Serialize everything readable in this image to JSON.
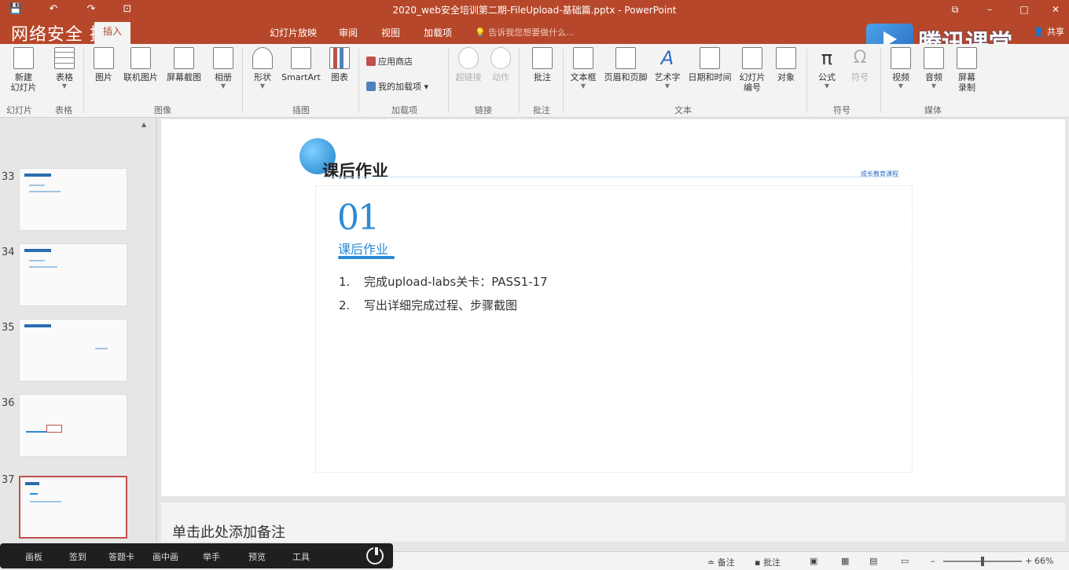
{
  "window": {
    "title": "2020_web安全培训第二期-FileUpload-基础篇.pptx - PowerPoint",
    "controls": {
      "restore": "⧉",
      "minimize": "–",
      "maximize": "□",
      "close": "✕"
    }
  },
  "quick_access": [
    "💾",
    "↶",
    "↷",
    "⊡"
  ],
  "overlay_title": "网络安全  推荐",
  "tabs": [
    {
      "label": "插入",
      "active": true
    },
    {
      "label": "幻灯片放映",
      "active": false
    },
    {
      "label": "审阅",
      "active": false
    },
    {
      "label": "视图",
      "active": false
    },
    {
      "label": "加载项",
      "active": false
    }
  ],
  "search_placeholder": "告诉我您想要做什么...",
  "share_label": "共享",
  "brand_text": "腾讯课堂",
  "ribbon": {
    "buttons": {
      "new_slide": "新建\n幻灯片",
      "table": "表格",
      "picture": "图片",
      "online_picture": "联机图片",
      "screenshot": "屏幕截图",
      "album": "相册",
      "shapes": "形状",
      "smartart": "SmartArt",
      "chart": "图表",
      "store": "应用商店",
      "my_addins": "我的加载项",
      "hyperlink": "超链接",
      "action": "动作",
      "comment": "批注",
      "textbox": "文本框",
      "header_footer": "页眉和页脚",
      "wordart": "艺术字",
      "datetime": "日期和时间",
      "slide_number": "幻灯片\n编号",
      "object": "对象",
      "equation": "公式",
      "symbol": "符号",
      "video": "视频",
      "audio": "音频",
      "screen_record": "屏幕\n录制"
    },
    "groups": {
      "slides": "幻灯片",
      "tables": "表格",
      "images": "图像",
      "illustrations": "插图",
      "addins": "加载项",
      "links": "链接",
      "comments": "批注",
      "text": "文本",
      "symbols": "符号",
      "media": "媒体"
    }
  },
  "thumbnails": [
    {
      "number": "33",
      "selected": false
    },
    {
      "number": "34",
      "selected": false
    },
    {
      "number": "35",
      "selected": false
    },
    {
      "number": "36",
      "selected": false
    },
    {
      "number": "37",
      "selected": true
    }
  ],
  "slide": {
    "title": "课后作业",
    "logo_text": "成长教育课程",
    "number": "01",
    "subheading": "课后作业",
    "items": [
      {
        "n": "1.",
        "text": "完成upload-labs关卡：PASS1-17"
      },
      {
        "n": "2.",
        "text": "写出详细完成过程、步骤截图"
      }
    ]
  },
  "notes_placeholder": "单击此处添加备注",
  "bottom_bar": [
    "画板",
    "签到",
    "答题卡",
    "画中画",
    "举手",
    "预览",
    "工具"
  ],
  "status_bar": {
    "notes": "备注",
    "comments": "批注",
    "zoom": "66%",
    "minus": "–",
    "plus": "+"
  },
  "colors": {
    "accent": "#b7472a",
    "slide_blue": "#2a8ad6"
  }
}
